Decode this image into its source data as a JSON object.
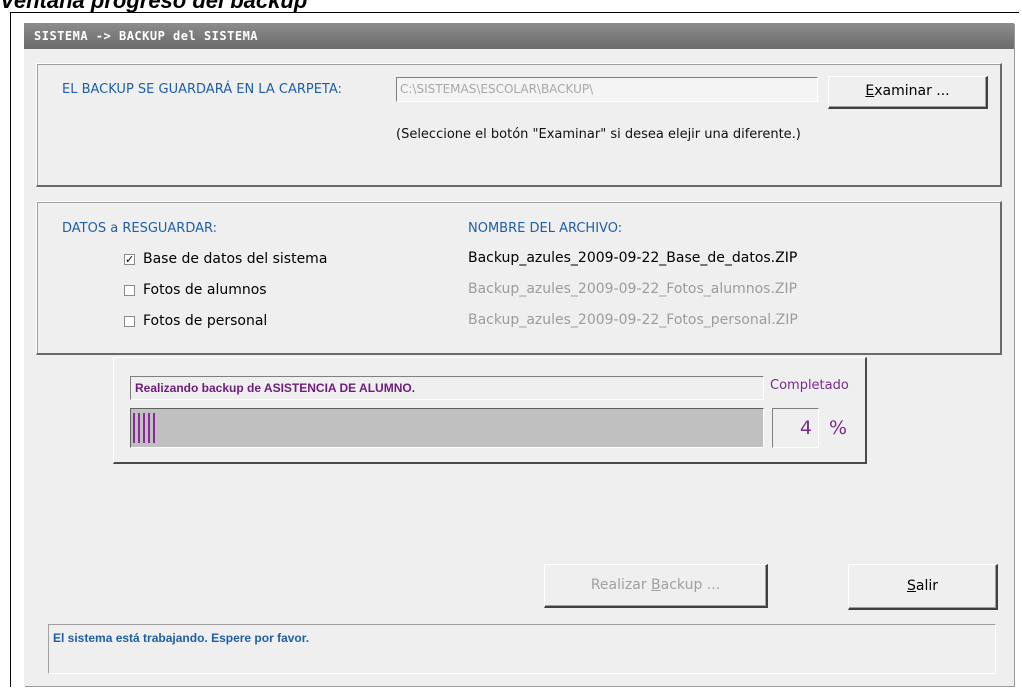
{
  "caption": "Ventana progreso del backup",
  "window": {
    "title": "SISTEMA -> BACKUP del SISTEMA"
  },
  "destination": {
    "label": "EL BACKUP SE GUARDARÁ EN LA CARPETA:",
    "path": "C:\\SISTEMAS\\ESCOLAR\\BACKUP\\",
    "browse_button": {
      "mnemonic": "E",
      "rest": "xaminar ..."
    },
    "hint": "(Seleccione el botón \"Examinar\" si desea elejir una diferente.)"
  },
  "data_section": {
    "heading": "DATOS a RESGUARDAR:",
    "filename_heading": "NOMBRE DEL ARCHIVO:",
    "items": [
      {
        "label": "Base de datos del sistema",
        "checked": true,
        "file": "Backup_azules_2009-09-22_Base_de_datos.ZIP"
      },
      {
        "label": "Fotos de alumnos",
        "checked": false,
        "file": "Backup_azules_2009-09-22_Fotos_alumnos.ZIP"
      },
      {
        "label": "Fotos de personal",
        "checked": false,
        "file": "Backup_azules_2009-09-22_Fotos_personal.ZIP"
      }
    ]
  },
  "progress": {
    "task": "Realizando backup de ASISTENCIA DE ALUMNO.",
    "completed_label": "Completado",
    "percent": "4",
    "percent_sign": "%",
    "fraction": 0.04
  },
  "buttons": {
    "run_backup": {
      "prefix": "Realizar ",
      "mnemonic": "B",
      "rest": "ackup ...",
      "enabled": false
    },
    "exit": {
      "mnemonic": "S",
      "rest": "alir"
    }
  },
  "status": {
    "text": "El sistema está trabajando. Espere por favor."
  },
  "colors": {
    "label_blue": "#1e5fa8",
    "progress_purple": "#7a2a8a",
    "titlebar_gray": "#7a7a7a"
  }
}
